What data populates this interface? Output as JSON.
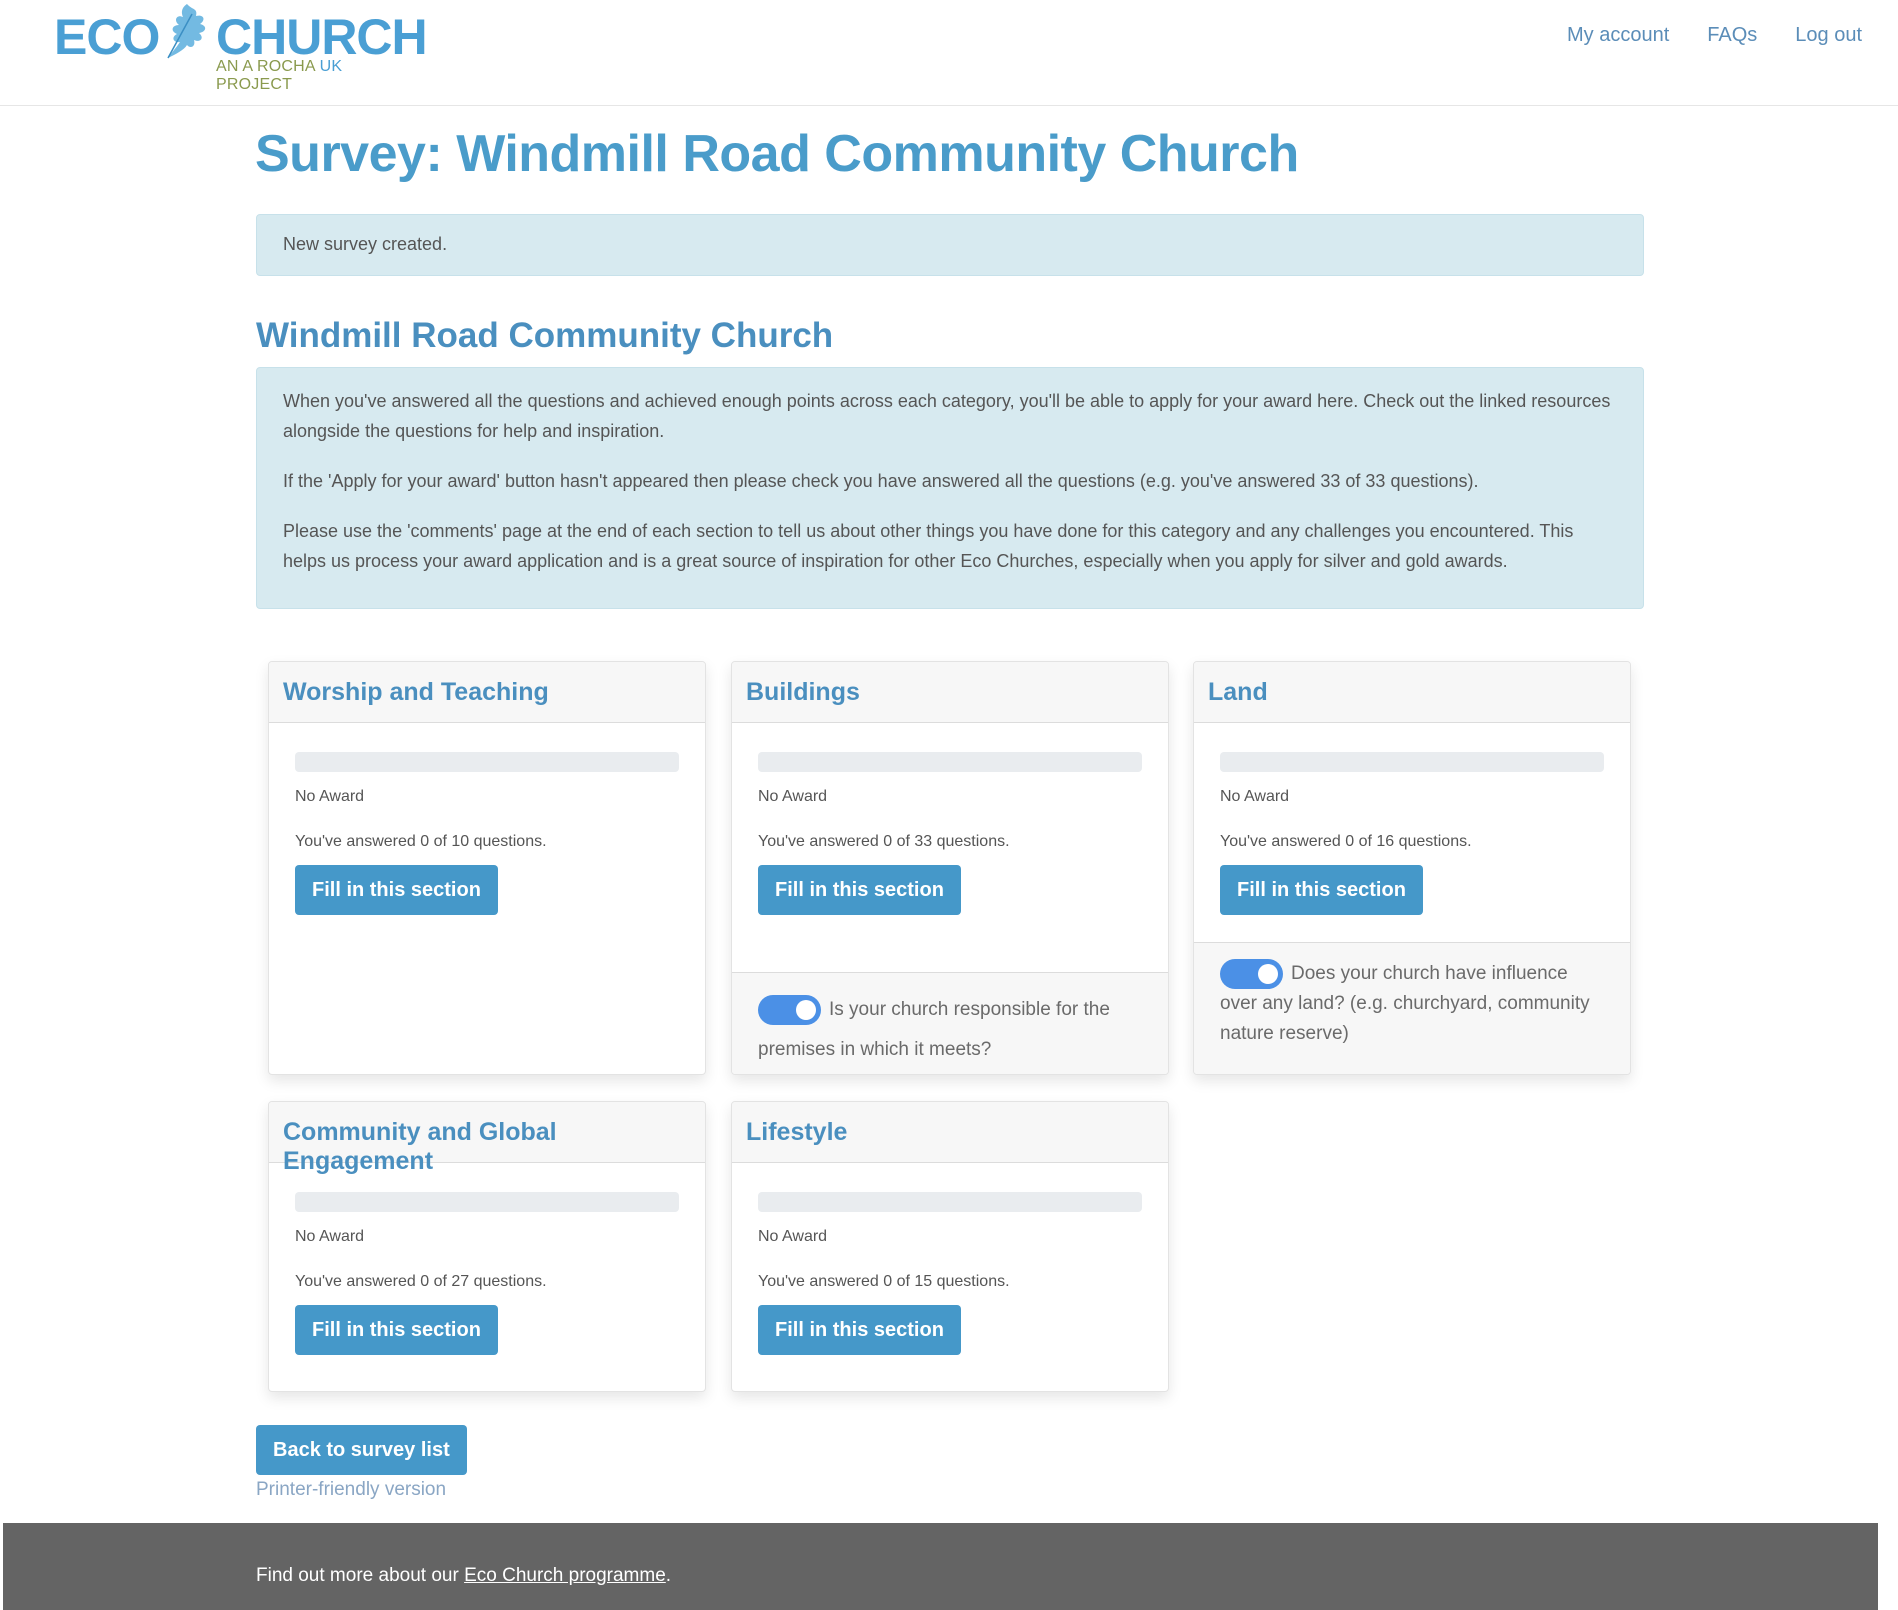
{
  "header": {
    "logo": {
      "word1": "ECO",
      "word2": "CHURCH",
      "tagline_a": "AN A ROCHA ",
      "tagline_b": "UK",
      "tagline_c": " PROJECT",
      "icon": "oak-leaf-icon"
    },
    "nav": [
      {
        "label": "My account"
      },
      {
        "label": "FAQs"
      },
      {
        "label": "Log out"
      }
    ]
  },
  "page": {
    "title": "Survey: Windmill Road Community Church",
    "alert": "New survey created.",
    "church_name": "Windmill Road Community Church",
    "info": [
      "When you've answered all the questions and achieved enough points across each category, you'll be able to apply for your award here. Check out the linked resources alongside the questions for help and inspiration.",
      "If the 'Apply for your award' button hasn't appeared then please check you have answered all the questions (e.g. you've answered 33 of 33 questions).",
      "Please use the 'comments' page at the end of each section to tell us about other things you have done for this category and any challenges you encountered. This helps us process your award application and is a great source of inspiration for other Eco Churches, especially when you apply for silver and gold awards."
    ]
  },
  "sections": [
    {
      "title": "Worship and Teaching",
      "progress": 0,
      "award": "No Award",
      "answered": "You've answered 0 of 10 questions.",
      "button": "Fill in this section"
    },
    {
      "title": "Buildings",
      "progress": 0,
      "award": "No Award",
      "answered": "You've answered 0 of 33 questions.",
      "button": "Fill in this section",
      "toggle": {
        "on": true,
        "label": "Is your church responsible for the premises in which it meets?"
      }
    },
    {
      "title": "Land",
      "progress": 0,
      "award": "No Award",
      "answered": "You've answered 0 of 16 questions.",
      "button": "Fill in this section",
      "toggle": {
        "on": true,
        "label": "Does your church have influence over any land? (e.g. churchyard, community nature reserve)"
      }
    },
    {
      "title": "Community and Global Engagement",
      "progress": 0,
      "award": "No Award",
      "answered": "You've answered 0 of 27 questions.",
      "button": "Fill in this section"
    },
    {
      "title": "Lifestyle",
      "progress": 0,
      "award": "No Award",
      "answered": "You've answered 0 of 15 questions.",
      "button": "Fill in this section"
    }
  ],
  "actions": {
    "back": "Back to survey list",
    "printer": "Printer-friendly version"
  },
  "footer": {
    "text_before": "Find out more about our ",
    "link": "Eco Church programme",
    "text_after": "."
  },
  "colors": {
    "brand_blue": "#4a9cca",
    "button_blue": "#4598c9",
    "toggle_blue": "#4b90e6",
    "alert_bg": "#d7eaf0",
    "footer_bg": "#646464",
    "tagline_green": "#8a9a4e"
  }
}
